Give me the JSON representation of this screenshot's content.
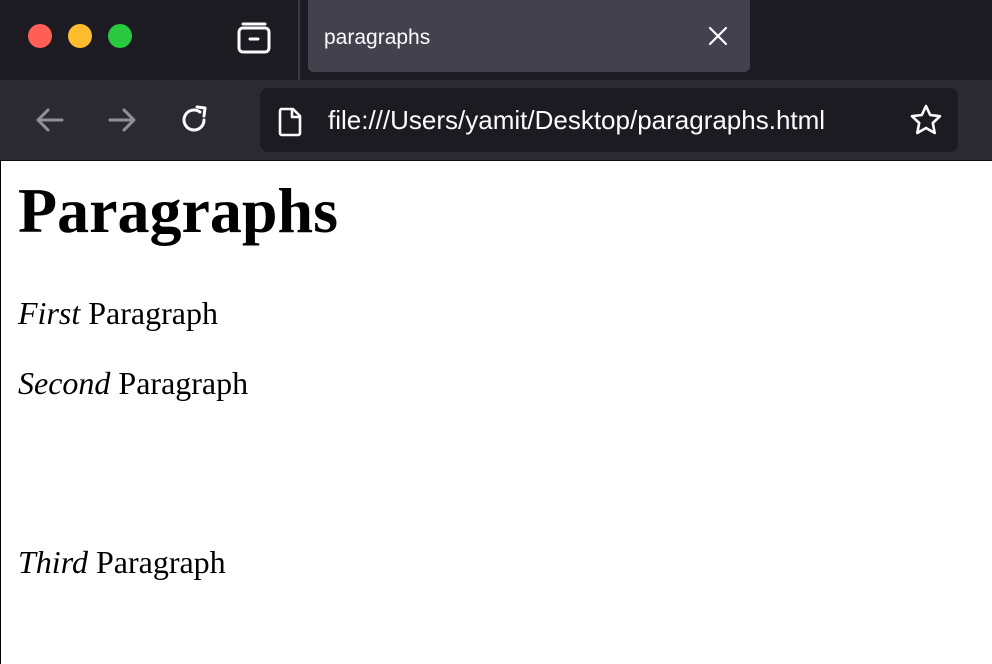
{
  "browser": {
    "tab": {
      "title": "paragraphs"
    },
    "url": "file:///Users/yamit/Desktop/paragraphs.html",
    "colors": {
      "tabstrip_bg": "#1c1b22",
      "tab_bg": "#42414d",
      "navbar_bg": "#2b2a33",
      "urlbar_bg": "#1c1b22",
      "close": "#ff5f57",
      "minimize": "#febc2e",
      "zoom": "#28c840"
    },
    "icons": {
      "tab_list": "tab-list-icon",
      "tab_close": "close-icon",
      "back": "back-arrow-icon",
      "forward": "forward-arrow-icon",
      "reload": "reload-icon",
      "page": "page-icon",
      "bookmark": "star-icon"
    }
  },
  "page": {
    "heading": "Paragraphs",
    "paragraphs": [
      {
        "emphasis": "First",
        "text": " Paragraph"
      },
      {
        "emphasis": "Second",
        "text": " Paragraph"
      },
      {
        "emphasis": "Third",
        "text": " Paragraph"
      }
    ]
  }
}
